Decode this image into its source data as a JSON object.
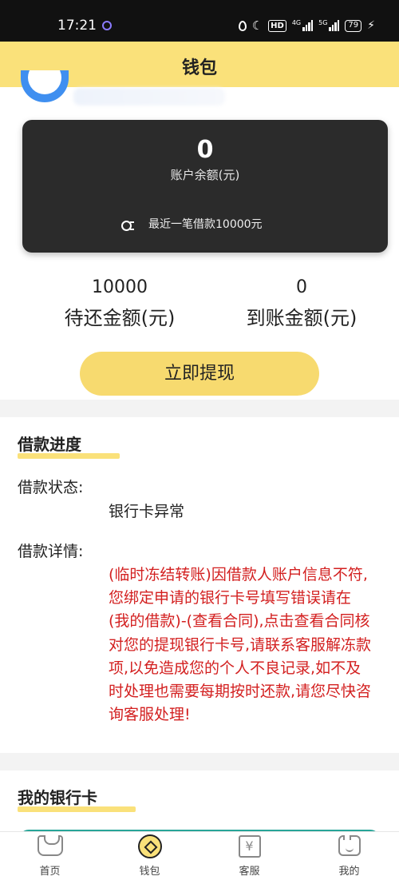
{
  "status_bar": {
    "time": "17:21",
    "network_1": "4G",
    "network_2": "5G",
    "hd": "HD",
    "battery": "79"
  },
  "header": {
    "title": "钱包"
  },
  "balance_card": {
    "amount": "0",
    "caption": "账户余额(元)",
    "recent_loan": "最近一笔借款10000元"
  },
  "stats": {
    "pending_repay_value": "10000",
    "pending_repay_label": "待还金额(元)",
    "received_value": "0",
    "received_label": "到账金额(元)"
  },
  "withdraw_button": {
    "label": "立即提现"
  },
  "loan_progress": {
    "title": "借款进度",
    "status_label": "借款状态:",
    "status_value": "银行卡异常",
    "details_label": "借款详情:",
    "details_text": "(临时冻结转账)因借款人账户信息不符,您绑定申请的银行卡号填写错误请在(我的借款)-(查看合同),点击查看合同核对您的提现银行卡号,请联系客服解冻款项,以免造成您的个人不良记录,如不及时处理也需要每期按时还款,请您尽快咨询客服处理!"
  },
  "bank_card_section": {
    "title": "我的银行卡"
  },
  "tab_bar": {
    "tabs": [
      {
        "label": "首页",
        "icon": "home-icon"
      },
      {
        "label": "钱包",
        "icon": "wallet-icon"
      },
      {
        "label": "客服",
        "icon": "service-icon",
        "glyph": "¥"
      },
      {
        "label": "我的",
        "icon": "mine-icon"
      }
    ],
    "active_tab": "钱包"
  },
  "colors": {
    "accent_yellow": "#fae17a",
    "card_dark": "#2b2b2b",
    "alert_red": "#d32020",
    "bank_card_teal": "#27a598"
  }
}
